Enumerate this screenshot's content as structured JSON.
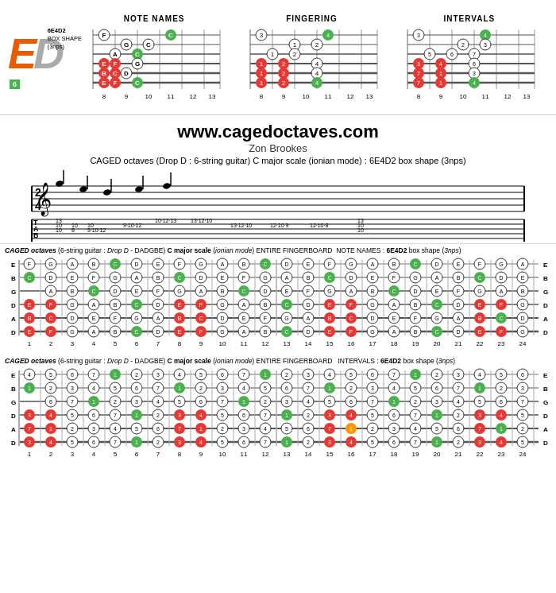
{
  "header": {
    "logo": "ED",
    "chord_id": "6E4D2",
    "box_shape": "BOX SHAPE",
    "nps": "(3nps)",
    "diagrams": [
      {
        "title": "NOTE NAMES"
      },
      {
        "title": "FINGERING"
      },
      {
        "title": "INTERVALS"
      }
    ]
  },
  "website": {
    "url": "www.cagedoctaves.com",
    "author": "Zon Brookes",
    "subtitle": "CAGED octaves (Drop D : 6-string guitar) C major scale (ionian mode) : 6E4D2 box shape (3nps)"
  },
  "notation": {
    "time_sig": "2/4"
  },
  "fingerboard_note_names": {
    "label": "CAGED octaves (6-string guitar : Drop D - DADGBE) C major scale (ionian mode) ENTIRE FINGERBOARD  NOTE NAMES : 6E4D2 box shape (3nps)",
    "strings": [
      "E",
      "B",
      "G",
      "D",
      "A",
      "D"
    ],
    "frets": [
      1,
      2,
      3,
      4,
      5,
      6,
      7,
      8,
      9,
      10,
      11,
      12,
      13,
      14,
      15,
      16,
      17,
      18,
      19,
      20,
      21,
      22,
      23,
      24
    ]
  },
  "fingerboard_intervals": {
    "label": "CAGED octaves (6-string guitar : Drop D - DADGBE) C major scale (ionian mode) ENTIRE FINGERBOARD  INTERVALS : 6E4D2 box shape (3nps)",
    "strings": [
      "E",
      "B",
      "G",
      "D",
      "A",
      "D"
    ],
    "frets": [
      1,
      2,
      3,
      4,
      5,
      6,
      7,
      8,
      9,
      10,
      11,
      12,
      13,
      14,
      15,
      16,
      17,
      18,
      19,
      20,
      21,
      22,
      23,
      24
    ]
  },
  "colors": {
    "green": "#4caf50",
    "orange": "#ff9800",
    "red": "#e53935",
    "black": "#212121",
    "white": "#ffffff",
    "gray": "#9e9e9e"
  }
}
